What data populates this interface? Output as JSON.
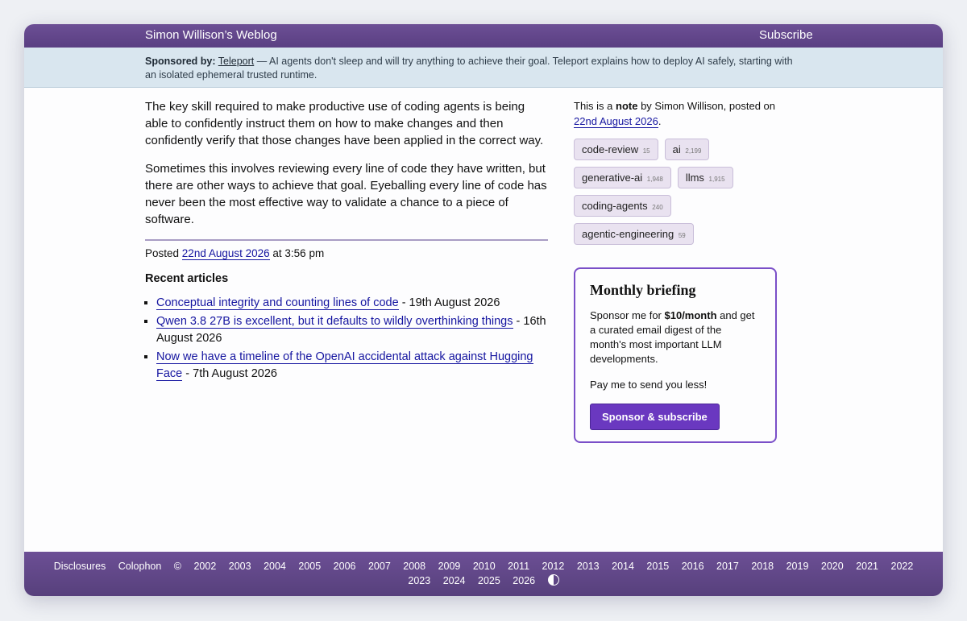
{
  "header": {
    "site_title": "Simon Willison’s Weblog",
    "subscribe": "Subscribe"
  },
  "sponsor": {
    "label": "Sponsored by:",
    "sponsor_name": "Teleport",
    "text": " — AI agents don't sleep and will try anything to achieve their goal. Teleport explains how to deploy AI safely, starting with an isolated ephemeral trusted runtime."
  },
  "article": {
    "paragraphs": [
      "The key skill required to make productive use of coding agents is being able to confidently instruct them on how to make changes and then confidently verify that those changes have been applied in the correct way.",
      "Sometimes this involves reviewing every line of code they have written, but there are other ways to achieve that goal. Eyeballing every line of code has never been the most effective way to validate a chance to a piece of software."
    ],
    "posted_prefix": "Posted",
    "posted_date": "22nd August 2026",
    "posted_time": " at 3:56 pm"
  },
  "recent": {
    "heading": "Recent articles",
    "items": [
      {
        "title": "Conceptual integrity and counting lines of code",
        "date": " - 19th August 2026"
      },
      {
        "title": "Qwen 3.8 27B is excellent, but it defaults to wildly overthinking things",
        "date": " - 16th August 2026"
      },
      {
        "title": "Now we have a timeline of the OpenAI accidental attack against Hugging Face",
        "date": " - 7th August 2026"
      }
    ]
  },
  "sidebar": {
    "meta_prefix": "This is a ",
    "meta_type": "note",
    "meta_mid": " by Simon Willison, posted on ",
    "meta_date": "22nd August 2026",
    "meta_end": ".",
    "tags": [
      {
        "name": "code-review",
        "count": "15"
      },
      {
        "name": "ai",
        "count": "2,199"
      },
      {
        "name": "generative-ai",
        "count": "1,948"
      },
      {
        "name": "llms",
        "count": "1,915"
      },
      {
        "name": "coding-agents",
        "count": "240"
      },
      {
        "name": "agentic-engineering",
        "count": "59"
      }
    ]
  },
  "briefing": {
    "title": "Monthly briefing",
    "text_prefix": "Sponsor me for ",
    "price": "$10/month",
    "text_suffix": " and get a curated email digest of the month's most important LLM developments.",
    "text2": "Pay me to send you less!",
    "button": "Sponsor & subscribe"
  },
  "footer": {
    "disclosures": "Disclosures",
    "colophon": "Colophon",
    "copyright": "©",
    "years": [
      "2002",
      "2003",
      "2004",
      "2005",
      "2006",
      "2007",
      "2008",
      "2009",
      "2010",
      "2011",
      "2012",
      "2013",
      "2014",
      "2015",
      "2016",
      "2017",
      "2018",
      "2019",
      "2020",
      "2021",
      "2022",
      "2023",
      "2024",
      "2025",
      "2026"
    ]
  },
  "colors": {
    "header_bg": "#6c4f95",
    "sponsor_bg": "#d9e6ef",
    "link": "#1515a0",
    "accent": "#6a38c0"
  }
}
